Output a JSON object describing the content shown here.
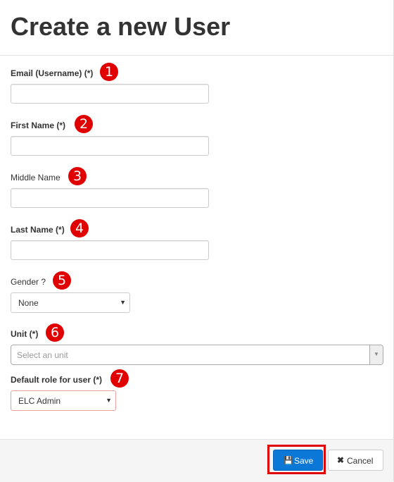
{
  "dialog": {
    "title": "Create a new User"
  },
  "fields": {
    "email": {
      "label": "Email (Username) (*)",
      "badge": "1",
      "value": ""
    },
    "first_name": {
      "label": "First Name (*)",
      "badge": "2",
      "value": ""
    },
    "middle_name": {
      "label": "Middle Name",
      "badge": "3",
      "value": ""
    },
    "last_name": {
      "label": "Last Name (*)",
      "badge": "4",
      "value": ""
    },
    "gender": {
      "label": "Gender ?",
      "badge": "5",
      "selected": "None"
    },
    "unit": {
      "label": "Unit (*)",
      "badge": "6",
      "placeholder": "Select an unit"
    },
    "role": {
      "label": "Default role for user (*)",
      "badge": "7",
      "selected": "ELC Admin"
    }
  },
  "footer": {
    "save_label": "Save",
    "save_icon": "floppy-disk-icon",
    "cancel_label": "Cancel",
    "cancel_icon": "close-x-icon"
  },
  "colors": {
    "primary": "#0b77d6",
    "highlight": "#e00000",
    "badge": "#e00000"
  }
}
